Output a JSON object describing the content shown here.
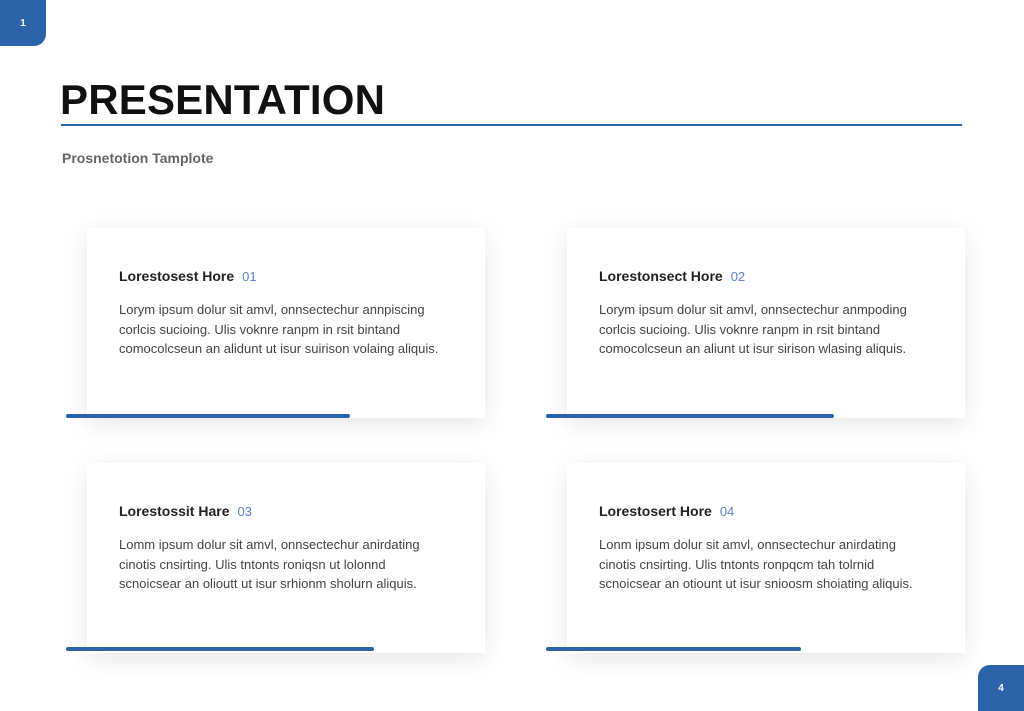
{
  "page": {
    "corner_left": "1",
    "corner_right": "4",
    "title": "PRESENTATION",
    "subtitle": "Prosnetotion Tamplote"
  },
  "colors": {
    "accent": "#2b62a8",
    "number": "#5b84c4"
  },
  "cards": [
    {
      "heading": "Lorestosest Hore",
      "number": "01",
      "body": "Lorym ipsum dolur sit amvl, onnsectechur annpiscing corlcis sucioing. Ulis voknre ranpm in rsit bintand comocolcseun an alidunt ut isur suirison volaing aliquis."
    },
    {
      "heading": "Lorestonsect Hore",
      "number": "02",
      "body": "Lorym ipsum dolur sit amvl, onnsectechur anmpoding corlcis sucioing. Ulis voknre ranpm in rsit bintand comocolcseun an aliunt ut isur sirison wlasing aliquis."
    },
    {
      "heading": "Lorestossit Hare",
      "number": "03",
      "body": "Lomm ipsum dolur sit amvl, onnsectechur anirdating cinotis cnsirting. Ulis tntonts roniqsn ut lolonnd scnoicsear an olioutt ut isur srhionm sholurn aliquis."
    },
    {
      "heading": "Lorestosert Hore",
      "number": "04",
      "body": "Lonm ipsum dolur sit amvl, onnsectechur anirdating cinotis cnsirting. Ulis tntonts ronpqcm tah tolrnid scnoicsear an otiount ut isur snioosm shoiating aliquis."
    }
  ]
}
